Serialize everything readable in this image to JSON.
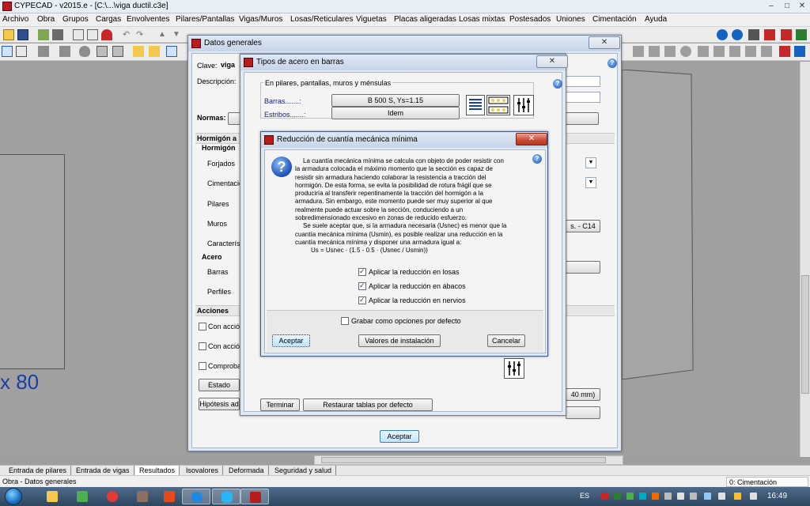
{
  "app": {
    "title": "CYPECAD - v2015.e - [C:\\...\\viga ductil.c3e]",
    "controls": {
      "minimize": "–",
      "maximize": "□",
      "close": "✕"
    }
  },
  "menu": [
    "Archivo",
    "Obra",
    "Grupos",
    "Cargas",
    "Envolventes",
    "Pilares/Pantallas",
    "Vigas/Muros",
    "Losas/Reticulares",
    "Viguetas",
    "Placas aligeradas",
    "Losas mixtas",
    "Postesados",
    "Uniones",
    "Cimentación",
    "Ayuda"
  ],
  "workarea": {
    "label": "x 80"
  },
  "bottom_tabs": [
    "Entrada de pilares",
    "Entrada de vigas",
    "Resultados",
    "Isovalores",
    "Deformada",
    "Seguridad y salud"
  ],
  "status": {
    "left": "Obra - Datos generales",
    "right": "0: Cimentación"
  },
  "taskbar": {
    "lang": "ES",
    "clock": "16:49"
  },
  "datos_generales": {
    "title": "Datos generales",
    "clave_label": "Clave:",
    "clave_value": "viga",
    "descripcion_label": "Descripción:",
    "normas_label": "Normas:",
    "hormigon_header": "Hormigón a",
    "hormigon_label": "Hormigón",
    "rows": [
      "Forjados",
      "Cimentación",
      "Pilares",
      "Muros",
      "Característ"
    ],
    "acero_label": "Acero",
    "acero_rows": [
      "Barras",
      "Perfiles"
    ],
    "acciones_header": "Acciones",
    "acciones_rows": [
      "Con acción",
      "Con acción",
      "Comprobar"
    ],
    "estado_btn": "Estado",
    "hipotesis_btn": "Hipótesis ad",
    "c14_text": "s. - C14",
    "mm_text": "40 mm)",
    "accept_btn": "Aceptar"
  },
  "tipos_acero": {
    "title": "Tipos de acero en barras",
    "group_label": "En pilares, pantallas, muros y ménsulas",
    "barras_label": "Barras.......:",
    "barras_value": "B 500 S, Ys=1.15",
    "estribos_label": "Estribos.......:",
    "estribos_value": "Idem",
    "btn_terminar": "Terminar",
    "btn_restaurar": "Restaurar tablas por defecto"
  },
  "reduccion": {
    "title": "Reducción de cuantía mecánica mínima",
    "para1": [
      "La cuantía mecánica mínima se calcula con objeto de poder resistir con",
      "la armadura colocada el máximo momento que la sección es capaz de",
      "resistir sin armadura haciendo colaborar la resistencia a tracción del",
      "hormigón. De esta forma, se evita la posibilidad de rotura frágil que se",
      "produciría al transferir repentinamente la tracción del hormigón a la",
      "armadura. Sin embargo, este momento puede ser muy superior al que",
      "realmente puede actuar sobre la sección, conduciendo a un",
      "sobredimensionado excesivo en zonas de reducido esfuerzo."
    ],
    "para2": [
      "Se suele aceptar que, si la armadura necesaria (Usnec) es menor que la",
      "cuantía mecánica mínima (Usmin), es posible realizar una reducción en la",
      "cuantía mecánica mínima y disponer una armadura igual a:",
      "Us = Usnec · (1.5 - 0.5 · (Usnec / Usmin))"
    ],
    "checks": [
      {
        "label": "Aplicar la reducción en losas",
        "checked": true
      },
      {
        "label": "Aplicar la reducción en ábacos",
        "checked": true
      },
      {
        "label": "Aplicar la reducción en nervios",
        "checked": true
      }
    ],
    "save_default_label": "Grabar como opciones por defecto",
    "save_default_checked": false,
    "btn_accept": "Aceptar",
    "btn_install": "Valores de instalación",
    "btn_cancel": "Cancelar"
  }
}
